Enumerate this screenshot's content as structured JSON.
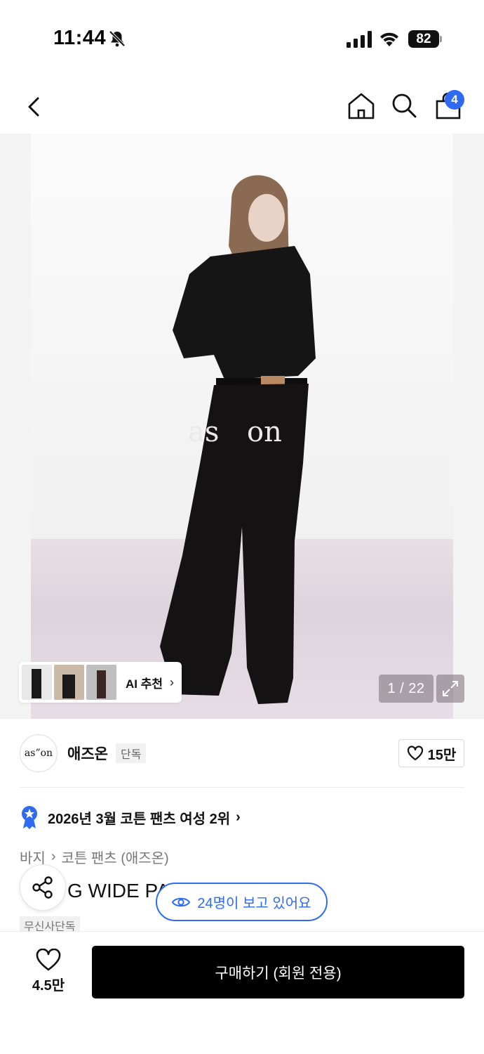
{
  "status_bar": {
    "time": "11:44",
    "battery": "82"
  },
  "top_nav": {
    "cart_count": "4"
  },
  "hero": {
    "ai_recommend_label": "AI 추천",
    "page_counter": "1 / 22"
  },
  "brand": {
    "logo_text": "as”on",
    "name": "애즈온",
    "tag": "단독",
    "likes": "15만"
  },
  "ranking": {
    "text": "2026년 3월 코튼 팬츠 여성 2위"
  },
  "breadcrumb": {
    "category": "바지",
    "subcategory": "코튼 팬츠 (애즈온)"
  },
  "product": {
    "title_visible": "G WIDE PA",
    "exclusive_tag": "무신사단독",
    "viewers_text": "24명이 보고 있어요"
  },
  "bottom_bar": {
    "wish_count": "4.5만",
    "buy_label": "구매하기 (회원 전용)"
  },
  "colors": {
    "accent_blue": "#2f6bf2",
    "buy_button": "#000000"
  }
}
